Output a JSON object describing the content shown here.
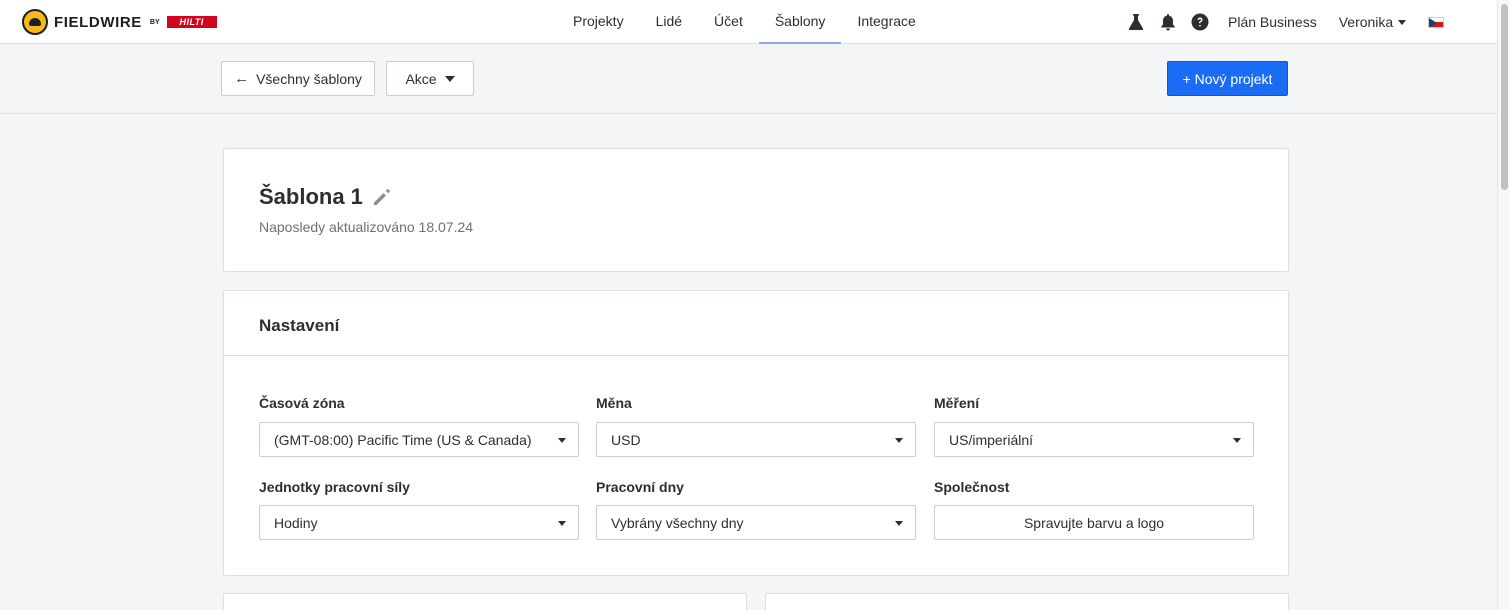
{
  "brand": {
    "name": "FIELDWIRE",
    "by": "BY",
    "partner": "HILTI"
  },
  "nav": {
    "links": [
      {
        "label": "Projekty",
        "active": false
      },
      {
        "label": "Lidé",
        "active": false
      },
      {
        "label": "Účet",
        "active": false
      },
      {
        "label": "Šablony",
        "active": true
      },
      {
        "label": "Integrace",
        "active": false
      }
    ],
    "icons": [
      "flask-icon",
      "bell-icon",
      "help-icon"
    ],
    "plan": "Plán Business",
    "user": "Veronika",
    "language_flag": "cz-flag-icon"
  },
  "toolbar": {
    "back_label": "Všechny šablony",
    "actions_label": "Akce",
    "new_project_label": "+ Nový projekt"
  },
  "template": {
    "name": "Šablona 1",
    "updated": "Naposledy aktualizováno 18.07.24"
  },
  "settings": {
    "title": "Nastavení",
    "timezone": {
      "label": "Časová zóna",
      "value": "(GMT-08:00) Pacific Time (US & Canada)"
    },
    "currency": {
      "label": "Měna",
      "value": "USD"
    },
    "measurement": {
      "label": "Měření",
      "value": "US/imperiální"
    },
    "labor_units": {
      "label": "Jednotky pracovní síly",
      "value": "Hodiny"
    },
    "work_days": {
      "label": "Pracovní dny",
      "value": "Vybrány všechny dny"
    },
    "company": {
      "label": "Společnost",
      "button": "Spravujte barvu a logo"
    }
  },
  "colors": {
    "primary": "#1a6cf5",
    "active_tab_underline": "#8aa9e6",
    "hilti_red": "#d2051e",
    "logo_yellow": "#f6b91a"
  }
}
